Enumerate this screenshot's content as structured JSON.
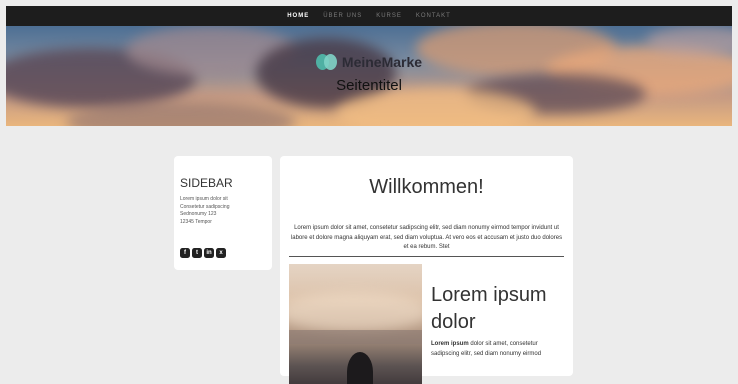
{
  "nav": {
    "items": [
      {
        "label": "HOME",
        "active": true
      },
      {
        "label": "ÜBER UNS",
        "active": false
      },
      {
        "label": "KURSE",
        "active": false
      },
      {
        "label": "KONTAKT",
        "active": false
      }
    ]
  },
  "hero": {
    "brand_name": "MeineMarke",
    "title": "Seitentitel"
  },
  "sidebar": {
    "heading": "SIDEBAR",
    "address_lines": [
      "Lorem ipsum dolor sit",
      "Consetetur sadipscing",
      "Sednonumy 123",
      "12345 Tempor"
    ],
    "social": [
      {
        "icon": "facebook-icon",
        "glyph": "f"
      },
      {
        "icon": "twitter-icon",
        "glyph": "t"
      },
      {
        "icon": "linkedin-icon",
        "glyph": "in"
      },
      {
        "icon": "xing-icon",
        "glyph": "x"
      }
    ]
  },
  "main": {
    "heading": "Willkommen!",
    "intro": "Lorem ipsum dolor sit amet, consetetur sadipscing elitr, sed diam nonumy eirmod tempor invidunt ut labore et dolore magna aliquyam erat, sed diam voluptua. At vero eos et accusam et justo duo dolores et ea rebum. Stet",
    "feature": {
      "title": "Lorem ipsum dolor",
      "text_bold": "Lorem ipsum",
      "text": " dolor sit amet, consetetur sadipscing elitr, sed diam nonumy eirmod"
    }
  },
  "colors": {
    "nav_bg": "#1d1d1d",
    "page_bg": "#ececec",
    "brand_teal": "#4fb0a3"
  }
}
